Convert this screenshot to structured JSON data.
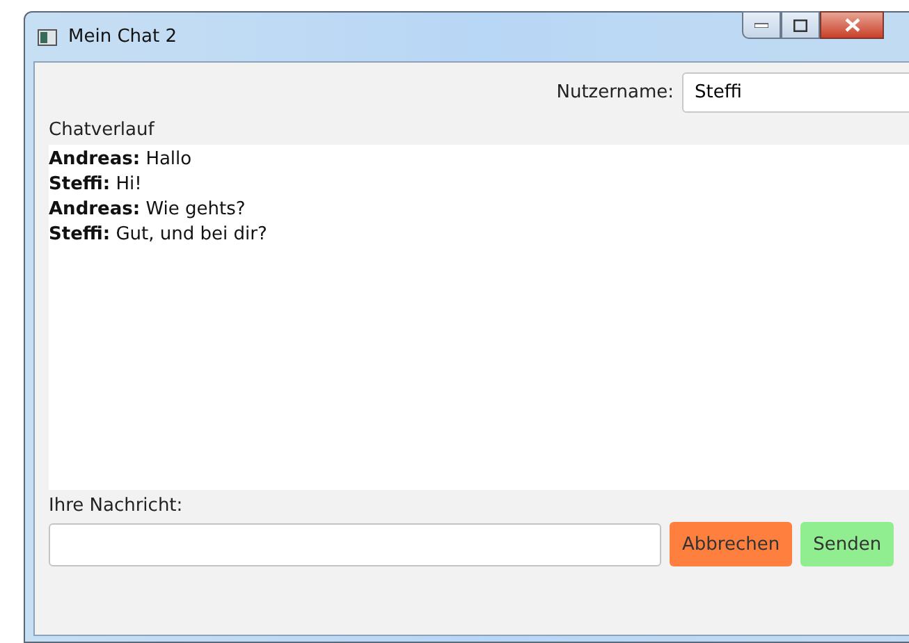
{
  "window": {
    "title": "Mein Chat 2"
  },
  "username": {
    "label": "Nutzername:",
    "value": "Steffi"
  },
  "history": {
    "label": "Chatverlauf",
    "messages": [
      {
        "sender": "Andreas:",
        "text": "Hallo"
      },
      {
        "sender": "Steffi:",
        "text": "Hi!"
      },
      {
        "sender": "Andreas:",
        "text": "Wie gehts?"
      },
      {
        "sender": "Steffi:",
        "text": "Gut, und bei dir?"
      }
    ]
  },
  "message": {
    "label": "Ihre Nachricht:"
  },
  "buttons": [
    {
      "label": "Abbrechen",
      "color": "#ff7f3f"
    },
    {
      "label": "Senden",
      "color": "#90ee90"
    }
  ]
}
